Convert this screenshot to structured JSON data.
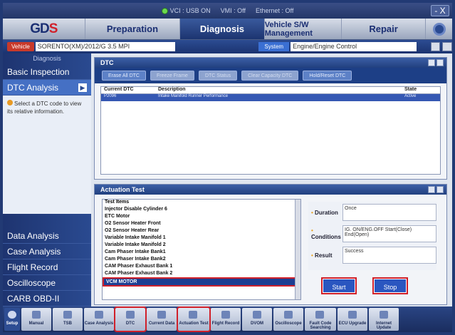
{
  "status": {
    "vci": "VCI : USB ON",
    "vmi": "VMI : Off",
    "ethernet": "Ethernet : Off",
    "min": "-  X"
  },
  "tabs": {
    "preparation": "Preparation",
    "diagnosis": "Diagnosis",
    "swm": "Vehicle S/W Management",
    "repair": "Repair"
  },
  "vehicle": {
    "button": "Vehicle",
    "value": "SORENTO(XM)/2012/G 3.5 MPI",
    "system_button": "System",
    "system_value": "Engine/Engine Control"
  },
  "left": {
    "diag_title": "Diagnosis",
    "basic": "Basic Inspection",
    "dtc": "DTC Analysis",
    "hint": "Select a DTC code to view its relative information.",
    "data": "Data Analysis",
    "case": "Case Analysis",
    "flight": "Flight Record",
    "osc": "Oscilloscope",
    "carb": "CARB OBD-II"
  },
  "dtc": {
    "title": "DTC",
    "buttons": [
      "Erase All DTC",
      "Freeze Frame",
      "DTC Status",
      "Clear Capacity DTC",
      "Hold/Reset DTC"
    ],
    "headers": {
      "code": "Current DTC",
      "desc": "Description",
      "state": "State"
    },
    "row": {
      "code": "P2096",
      "desc": "Intake Manifold Runner Performance",
      "state": "Active"
    }
  },
  "actuation": {
    "title": "Actuation Test",
    "list_header": "Test Items",
    "items": [
      "Injector Disable Cylinder 6",
      "ETC Motor",
      "O2 Sensor Heater Front",
      "O2 Sensor Heater Rear",
      "Variable Intake Manifold 1",
      "Variable Intake Manifold 2",
      "Cam Phaser Intake Bank1",
      "Cam Phaser Intake Bank2",
      "CAM Phaser Exhaust Bank 1",
      "CAM Phaser Exhaust Bank 2",
      "VCM MOTOR"
    ],
    "duration_label": "Duration",
    "duration": "Once",
    "conditions_label": "Conditions",
    "conditions": "IG. ON/ENG.OFF Start(Close) End(Open)",
    "result_label": "Result",
    "result": "Success",
    "start": "Start",
    "stop": "Stop"
  },
  "bottom": [
    "Setup",
    "Manual",
    "TSB",
    "Case Analysis",
    "DTC",
    "Current Data",
    "Actuation Test",
    "Flight Record",
    "DVOM",
    "Oscilloscope",
    "Fault Code Searching",
    "ECU Upgrade",
    "Internet Update"
  ]
}
